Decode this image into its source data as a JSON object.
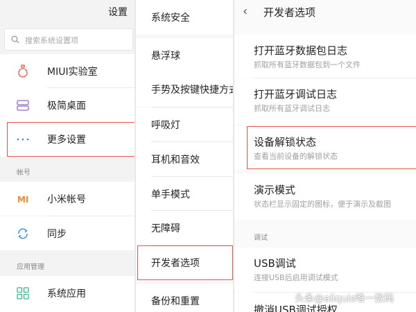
{
  "left_panel": {
    "title": "设置",
    "search_placeholder": "搜索系统设置项",
    "items_top": [
      {
        "label": "MIUI实验室",
        "icon": "flask-icon"
      },
      {
        "label": "极简桌面",
        "icon": "layers-icon"
      },
      {
        "label": "更多设置",
        "icon": "more-dots-icon"
      }
    ],
    "section_account": "帐号",
    "items_account": [
      {
        "label": "小米帐号",
        "icon": "mi-logo-icon"
      },
      {
        "label": "同步",
        "icon": "sync-icon"
      }
    ],
    "section_apps": "应用管理",
    "items_apps": [
      {
        "label": "系统应用",
        "icon": "grid-icon"
      }
    ]
  },
  "middle_panel": {
    "items": [
      "系统安全",
      "悬浮球",
      "手势及按键快捷方式",
      "呼吸灯",
      "耳机和音效",
      "单手模式",
      "无障碍",
      "开发者选项",
      "备份和重置"
    ]
  },
  "right_panel": {
    "title": "开发者选项",
    "items": [
      {
        "label": "打开蓝牙数据包日志",
        "sub": "抓取所有蓝牙数据包到一个文件"
      },
      {
        "label": "打开蓝牙调试日志",
        "sub": "抓取所有蓝牙调试日志"
      },
      {
        "label": "设备解锁状态",
        "sub": "查看当前设备的解锁状态"
      },
      {
        "label": "演示模式",
        "sub": "状态栏显示固定的图标，便于演示及截图"
      }
    ],
    "section_debug": "调试",
    "debug_items": [
      {
        "label": "USB调试",
        "sub": "连接USB后启用调试模式"
      }
    ],
    "partial_item": "撤消USB调试授权"
  },
  "watermark": "头条@aliquis唯一数码",
  "colors": {
    "highlight": "#e8554f",
    "accent_orange": "#f08a2a",
    "accent_blue": "#2a8ae0"
  }
}
